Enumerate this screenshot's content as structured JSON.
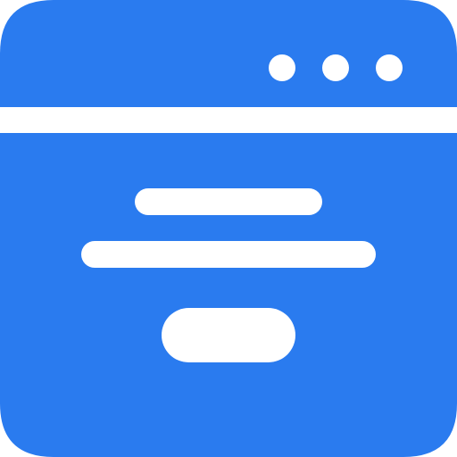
{
  "icon": {
    "name": "browser-window-icon",
    "color_primary": "#2a7bef",
    "color_background": "#ffffff",
    "window_control_dots": 3
  }
}
